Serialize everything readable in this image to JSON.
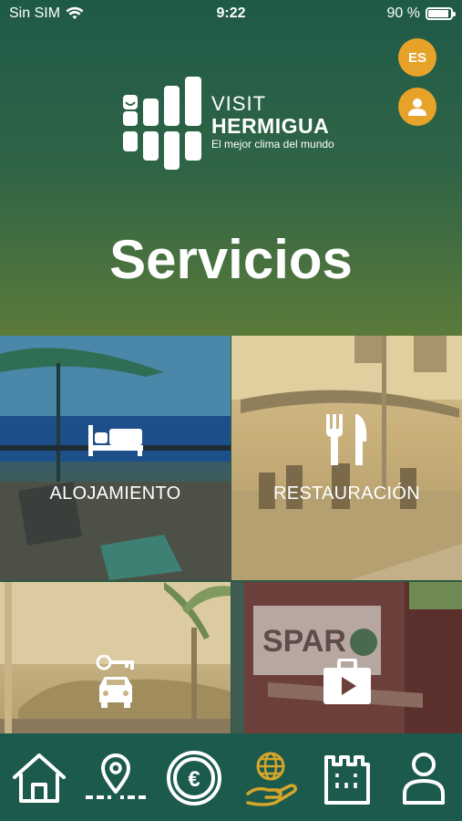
{
  "status": {
    "carrier": "Sin SIM",
    "time": "9:22",
    "battery": "90 %"
  },
  "header": {
    "lang_button": "ES",
    "logo": {
      "visit": "VISIT",
      "name": "HERMIGUA",
      "tagline": "El mejor clima del mundo"
    },
    "title": "Servicios"
  },
  "services": [
    {
      "label": "ALOJAMIENTO",
      "icon": "bed-icon"
    },
    {
      "label": "RESTAURACIÓN",
      "icon": "fork-knife-icon"
    },
    {
      "label": "",
      "icon": "car-key-icon"
    },
    {
      "label": "",
      "icon": "shopping-bag-icon"
    }
  ],
  "tabbar": {
    "tabs": [
      {
        "icon": "home-icon"
      },
      {
        "icon": "route-pin-icon"
      },
      {
        "icon": "euro-coin-icon"
      },
      {
        "icon": "globe-hand-icon",
        "active": true
      },
      {
        "icon": "castle-tower-icon"
      },
      {
        "icon": "person-icon"
      }
    ]
  },
  "colors": {
    "accent": "#e7a22a",
    "active_tab": "#d4a62a",
    "tabbar_bg": "#1c5a4e"
  }
}
